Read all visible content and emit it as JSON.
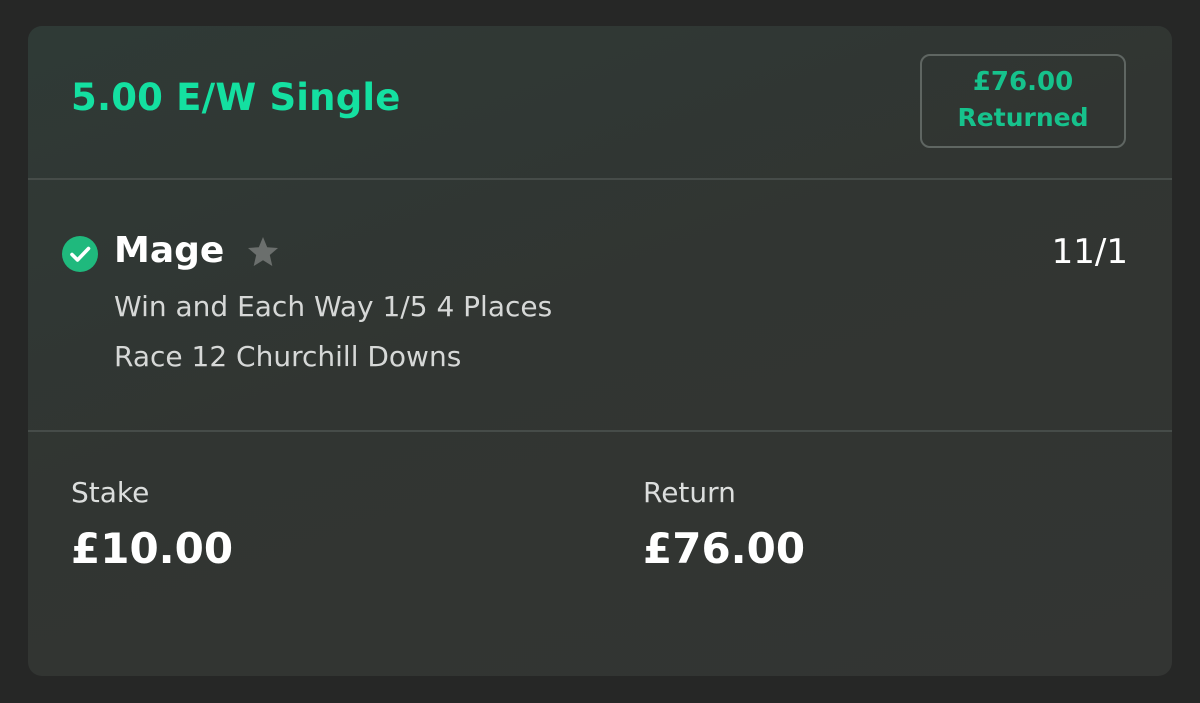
{
  "bet": {
    "title": "5.00 E/W Single",
    "returned_amount": "£76.00",
    "returned_label": "Returned"
  },
  "selection": {
    "name": "Mage",
    "odds": "11/1",
    "market": "Win and Each Way 1/5 4 Places",
    "event": "Race 12 Churchill Downs",
    "status_icon": "check-circle-icon",
    "favourite_icon": "star-icon"
  },
  "summary": {
    "stake_label": "Stake",
    "stake_value": "£10.00",
    "return_label": "Return",
    "return_value": "£76.00"
  },
  "colors": {
    "accent": "#14e0a1",
    "returned_text": "#16c28c",
    "card_bg": "#313532",
    "page_bg": "#262726"
  }
}
